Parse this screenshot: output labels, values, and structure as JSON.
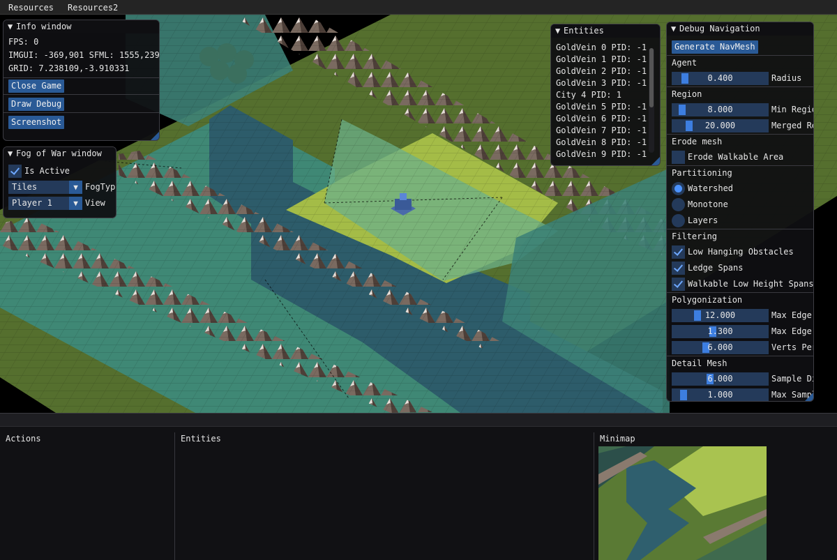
{
  "menubar": [
    "Resources",
    "Resources2"
  ],
  "info_window": {
    "title": "Info window",
    "fps": "FPS: 0",
    "coords": "IMGUI: -369,901 SFML: 1555,239",
    "grid": "GRID: 7.238109,-3.910331",
    "buttons": [
      "Close Game",
      "Draw Debug",
      "Screenshot"
    ]
  },
  "fog_window": {
    "title": "Fog of War window",
    "is_active_label": "Is Active",
    "fog_type_value": "Tiles",
    "fog_type_label": "FogTyp",
    "view_value": "Player 1",
    "view_label": "View"
  },
  "entities_window": {
    "title": "Entities",
    "items": [
      "GoldVein 0 PID: -1",
      "GoldVein 1 PID: -1",
      "GoldVein 2 PID: -1",
      "GoldVein 3 PID: -1",
      "City 4 PID: 1",
      "GoldVein 5 PID: -1",
      "GoldVein 6 PID: -1",
      "GoldVein 7 PID: -1",
      "GoldVein 8 PID: -1",
      "GoldVein 9 PID: -1"
    ]
  },
  "nav_window": {
    "title": "Debug Navigation",
    "generate_button": "Generate NavMesh",
    "agent_header": "Agent",
    "radius_value": "0.400",
    "radius_label": "Radius",
    "region_header": "Region",
    "min_region_value": "8.000",
    "min_region_label": "Min Regio",
    "merged_value": "20.000",
    "merged_label": "Merged Re",
    "erode_header": "Erode mesh",
    "erode_label": "Erode Walkable Area",
    "partition_header": "Partitioning",
    "partitions": [
      "Watershed",
      "Monotone",
      "Layers"
    ],
    "filter_header": "Filtering",
    "filters": [
      "Low Hanging Obstacles",
      "Ledge Spans",
      "Walkable Low Height Spans"
    ],
    "poly_header": "Polygonization",
    "max_edge_len_value": "12.000",
    "max_edge_len_label": "Max Edge",
    "max_edge_err_value": "1.300",
    "max_edge_err_label": "Max Edge",
    "verts_value": "6.000",
    "verts_label": "Verts Per",
    "detail_header": "Detail Mesh",
    "sample_dist_value": "6.000",
    "sample_dist_label": "Sample Di",
    "max_sample_value": "1.000",
    "max_sample_label": "Max Sampl"
  },
  "bottom": {
    "actions_title": "Actions",
    "entities_title": "Entities",
    "minimap_title": "Minimap"
  },
  "colors": {
    "grass": "#5a7a34",
    "grass_light": "#a6c24c",
    "water": "#2e5a66",
    "navmesh": "#4a9a86",
    "accent": "#2a5a96"
  }
}
